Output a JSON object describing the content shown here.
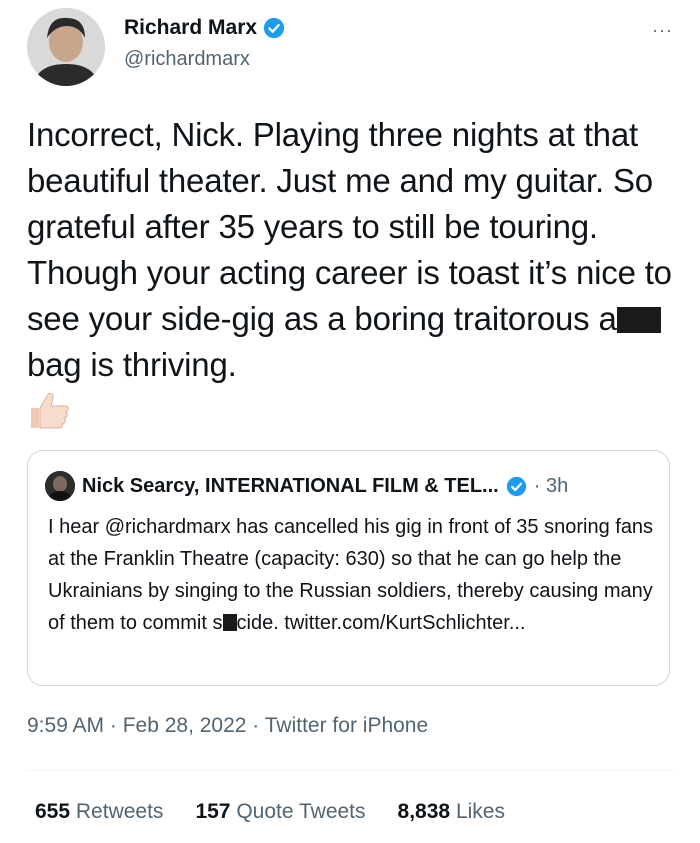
{
  "author": {
    "name": "Richard Marx",
    "handle": "@richardmarx",
    "more_label": "···"
  },
  "tweet": {
    "text_before": "Incorrect, Nick. Playing three nights at that beautiful theater. Just me and my guitar. So grateful after 35 years to still be touring. Though your acting career is toast it’s nice to see your side-gig as a boring traitorous a",
    "text_after": "bag is thriving.",
    "emoji": "thumbs-up"
  },
  "quoted": {
    "name": "Nick Searcy, INTERNATIONAL FILM & TEL...",
    "time": "· 3h",
    "text_before": "I hear @richardmarx has cancelled his gig in front of 35 snoring fans at the Franklin Theatre (capacity: 630) so that he can go help the Ukrainians by singing to the Russian soldiers, thereby causing many of them to commit s",
    "text_after": "cide. twitter.com/KurtSchlichter..."
  },
  "meta": "9:59 AM · Feb 28, 2022 · Twitter for iPhone",
  "stats": [
    {
      "num": "655",
      "label": "Retweets"
    },
    {
      "num": "157",
      "label": "Quote Tweets"
    },
    {
      "num": "8,838",
      "label": "Likes"
    }
  ],
  "colors": {
    "verified": "#1d9bf0",
    "secondary_text": "#536471",
    "border": "#cfd9de"
  }
}
